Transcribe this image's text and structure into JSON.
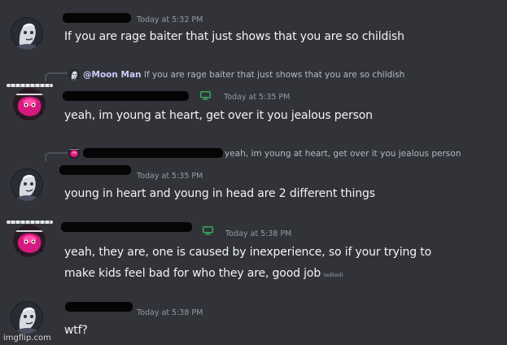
{
  "messages": [
    {
      "author": "Moon Man",
      "timestamp": "Today at 5:32 PM",
      "lines": [
        "If you are rage baiter that just shows that you are so childish"
      ]
    },
    {
      "reply": {
        "author": "@Moon Man",
        "text": "If you are rage baiter that just shows that you are so childish"
      },
      "timestamp": "Today at 5:35 PM",
      "lines": [
        "yeah, im young at heart, get over it you jealous person"
      ]
    },
    {
      "reply": {
        "text": "yeah, im young at heart, get over it you jealous person"
      },
      "timestamp": "Today at 5:35 PM",
      "lines": [
        "young in heart and young in head are 2 different things"
      ]
    },
    {
      "timestamp": "Today at 5:38 PM",
      "lines": [
        "yeah, they are, one is caused by inexperience, so if your trying to",
        "make kids feel bad for who they are, good job"
      ],
      "edited_label": "(edited)"
    },
    {
      "timestamp": "Today at 5:38 PM",
      "lines": [
        "wtf?"
      ]
    }
  ],
  "watermark": "imgflip.com",
  "colors": {
    "background": "#313338",
    "text": "#f2f3f5",
    "muted": "#949ba4",
    "mention": "#c9cdfb",
    "redaction": "#050505"
  },
  "icons": [
    "moon-man-avatar",
    "pink-avatar",
    "monitor-icon"
  ]
}
